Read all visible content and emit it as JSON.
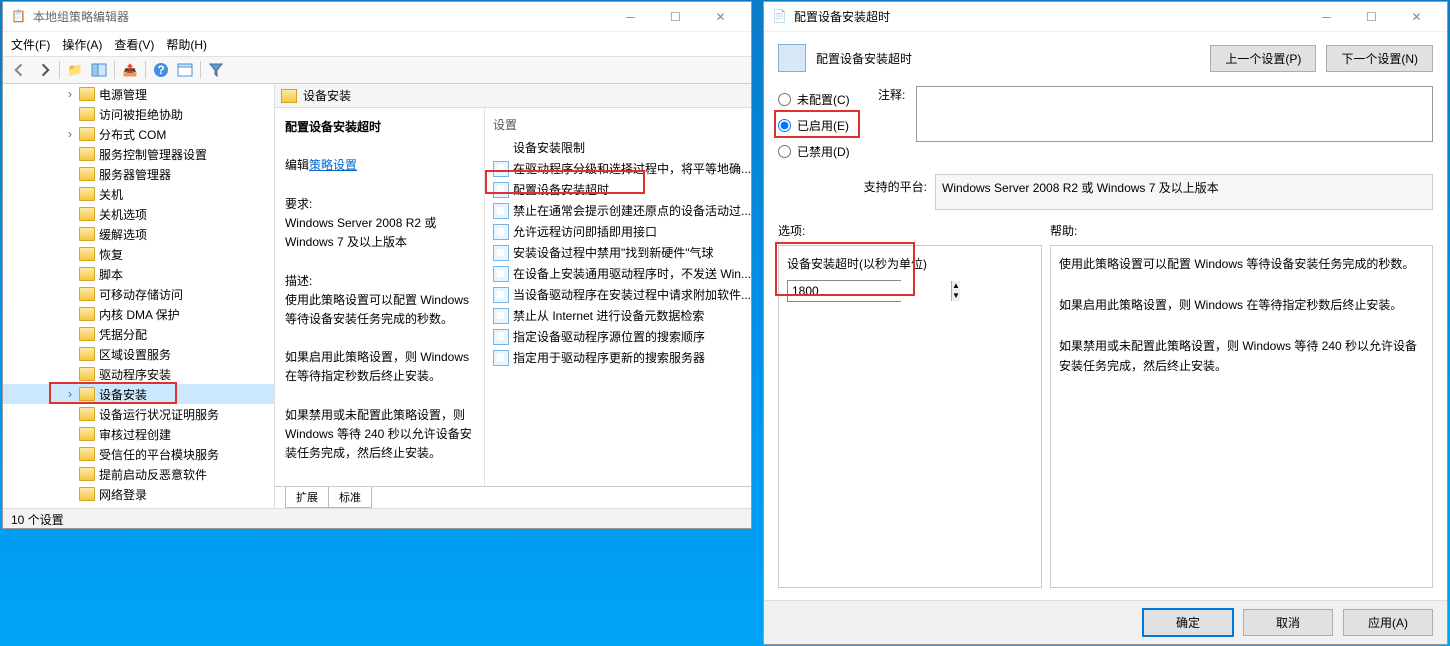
{
  "win1": {
    "title": "本地组策略编辑器",
    "menus": [
      "文件(F)",
      "操作(A)",
      "查看(V)",
      "帮助(H)"
    ],
    "tree": [
      "电源管理",
      "访问被拒绝协助",
      "分布式 COM",
      "服务控制管理器设置",
      "服务器管理器",
      "关机",
      "关机选项",
      "缓解选项",
      "恢复",
      "脚本",
      "可移动存储访问",
      "内核 DMA 保护",
      "凭据分配",
      "区域设置服务",
      "驱动程序安装",
      "设备安装",
      "设备运行状况证明服务",
      "审核过程创建",
      "受信任的平台模块服务",
      "提前启动反恶意软件",
      "网络登录"
    ],
    "selected_index": 15,
    "content_header": "设备安装",
    "policy_title": "配置设备安装超时",
    "edit_label": "编辑",
    "edit_link": "策略设置",
    "req_label": "要求:",
    "req_text": "Windows Server 2008 R2 或 Windows 7 及以上版本",
    "desc_label": "描述:",
    "desc_text": "使用此策略设置可以配置 Windows 等待设备安装任务完成的秒数。\n\n如果启用此策略设置，则 Windows 在等待指定秒数后终止安装。\n\n如果禁用或未配置此策略设置，则 Windows 等待 240 秒以允许设备安装任务完成，然后终止安装。",
    "col_header": "设置",
    "settings": [
      "设备安装限制",
      "在驱动程序分级和选择过程中，将平等地确...",
      "配置设备安装超时",
      "禁止在通常会提示创建还原点的设备活动过...",
      "允许远程访问即插即用接口",
      "安装设备过程中禁用\"找到新硬件\"气球",
      "在设备上安装通用驱动程序时，不发送 Win...",
      "当设备驱动程序在安装过程中请求附加软件...",
      "禁止从 Internet 进行设备元数据检索",
      "指定设备驱动程序源位置的搜索顺序",
      "指定用于驱动程序更新的搜索服务器"
    ],
    "settings_selected": 2,
    "settings_folder_index": 0,
    "tabs": [
      "扩展",
      "标准"
    ],
    "status": "10 个设置"
  },
  "win2": {
    "title": "配置设备安装超时",
    "subtitle": "配置设备安装超时",
    "prev_btn": "上一个设置(P)",
    "next_btn": "下一个设置(N)",
    "radio_unconfigured": "未配置(C)",
    "radio_enabled": "已启用(E)",
    "radio_disabled": "已禁用(D)",
    "comment_label": "注释:",
    "comment_value": "",
    "platform_label": "支持的平台:",
    "platform_value": "Windows Server 2008 R2 或 Windows 7 及以上版本",
    "options_label": "选项:",
    "help_label": "帮助:",
    "option_name": "设备安装超时(以秒为单位)",
    "option_value": "1800",
    "help_text": "使用此策略设置可以配置 Windows 等待设备安装任务完成的秒数。\n\n如果启用此策略设置，则 Windows 在等待指定秒数后终止安装。\n\n如果禁用或未配置此策略设置，则 Windows 等待 240 秒以允许设备安装任务完成，然后终止安装。",
    "ok": "确定",
    "cancel": "取消",
    "apply": "应用(A)"
  }
}
